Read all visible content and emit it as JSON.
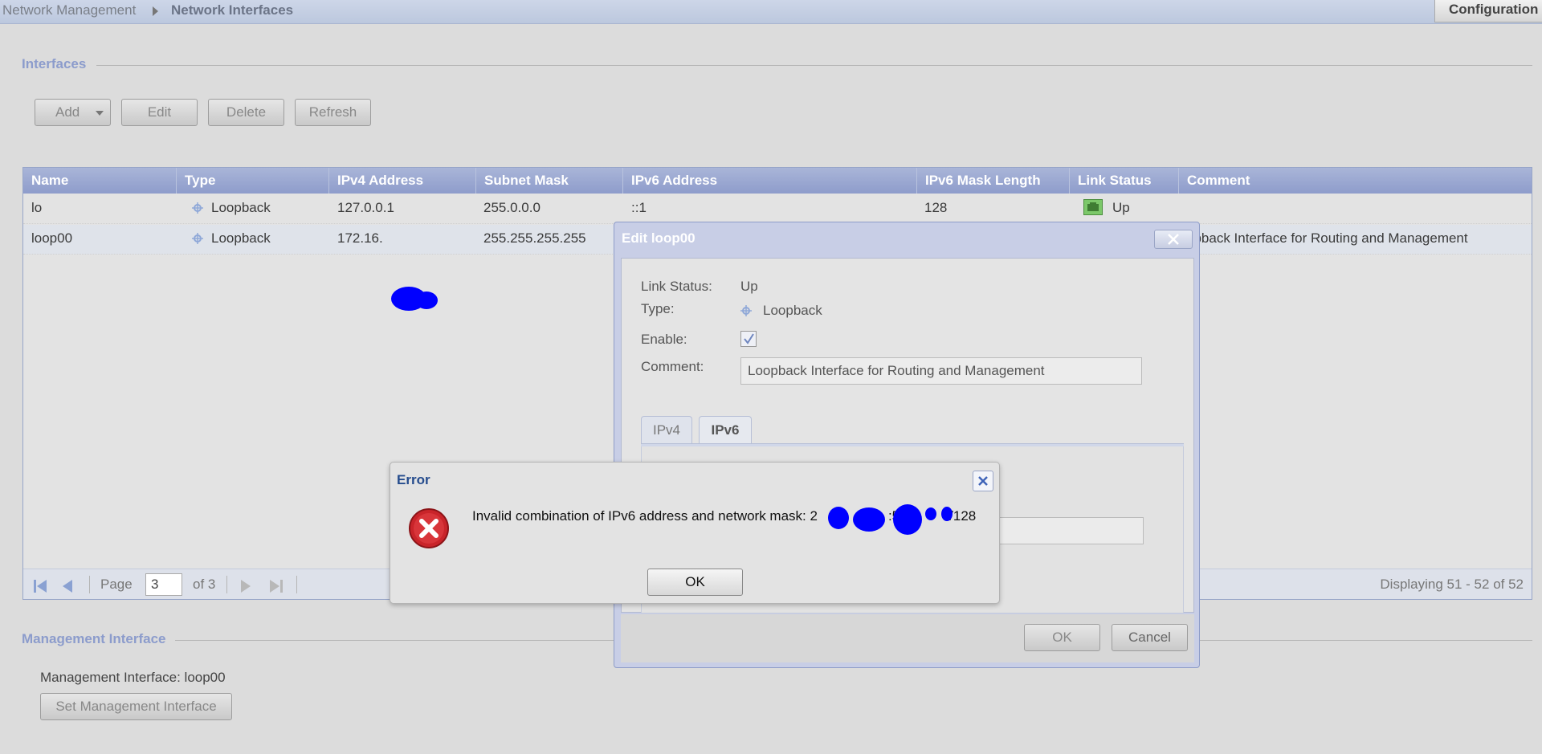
{
  "breadcrumb": {
    "parent": "Network Management",
    "current": "Network Interfaces"
  },
  "config_button": "Configuration",
  "interfaces": {
    "title": "Interfaces",
    "toolbar": {
      "add": "Add",
      "edit": "Edit",
      "delete": "Delete",
      "refresh": "Refresh"
    },
    "columns": [
      "Name",
      "Type",
      "IPv4 Address",
      "Subnet Mask",
      "IPv6 Address",
      "IPv6 Mask Length",
      "Link Status",
      "Comment"
    ],
    "rows": [
      {
        "name": "lo",
        "type": "Loopback",
        "ipv4": "127.0.0.1",
        "mask": "255.0.0.0",
        "ipv6": "::1",
        "ipv6_len": "128",
        "link": "Up",
        "comment": ""
      },
      {
        "name": "loop00",
        "type": "Loopback",
        "ipv4": "172.16.",
        "mask": "255.255.255.255",
        "ipv6": "",
        "ipv6_len": "",
        "link": "",
        "comment": "opback Interface for Routing and Management"
      }
    ],
    "pager": {
      "page_label": "Page",
      "page": "3",
      "of": "of 3",
      "displaying": "Displaying 51 - 52 of 52"
    }
  },
  "management": {
    "title": "Management Interface",
    "current": "Management Interface: loop00",
    "set_button": "Set Management Interface"
  },
  "edit_window": {
    "title": "Edit loop00",
    "link_status_label": "Link Status:",
    "link_status": "Up",
    "type_label": "Type:",
    "type": "Loopback",
    "enable_label": "Enable:",
    "enabled": true,
    "comment_label": "Comment:",
    "comment": "Loopback Interface for Routing and Management",
    "tabs": [
      {
        "label": "IPv4",
        "active": false
      },
      {
        "label": "IPv6",
        "active": true
      }
    ],
    "ok": "OK",
    "cancel": "Cancel"
  },
  "error_dialog": {
    "title": "Error",
    "message_prefix": "Invalid combination of IPv6 address and network mask: 2",
    "message_mid": ":5",
    "message_suffix": "/128",
    "ok": "OK"
  },
  "colors": {
    "header": "#8e9ccb",
    "section_title": "#8c9ccc",
    "link_up": "#5aa64a",
    "error_icon": "#c9242a",
    "redaction": "#0000ff"
  }
}
